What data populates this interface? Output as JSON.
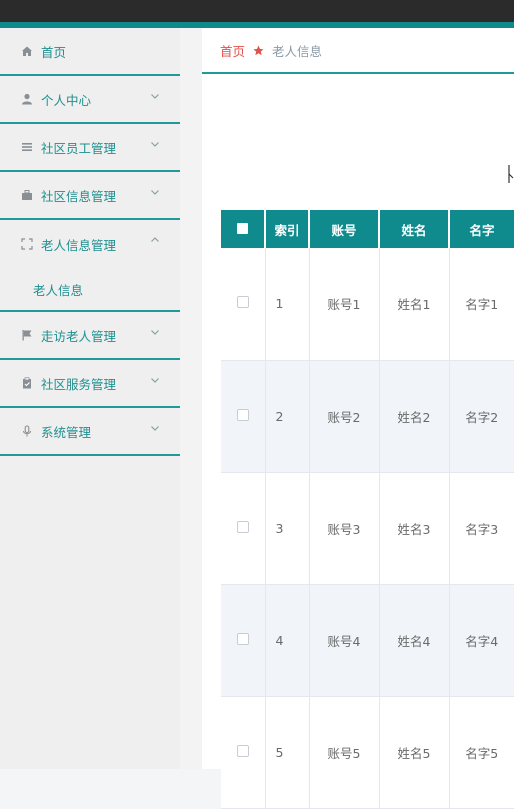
{
  "breadcrumb": {
    "home": "首页",
    "current": "老人信息"
  },
  "sidebar": {
    "items": [
      {
        "label": "首页",
        "icon": "home-icon"
      },
      {
        "label": "个人中心",
        "icon": "user-icon"
      },
      {
        "label": "社区员工管理",
        "icon": "list-icon"
      },
      {
        "label": "社区信息管理",
        "icon": "briefcase-icon"
      },
      {
        "label": "老人信息管理",
        "icon": "fullscreen-icon",
        "sub": "老人信息"
      },
      {
        "label": "走访老人管理",
        "icon": "flag-icon"
      },
      {
        "label": "社区服务管理",
        "icon": "clipboard-icon"
      },
      {
        "label": "系统管理",
        "icon": "microphone-icon"
      }
    ]
  },
  "table": {
    "headers": [
      "索引",
      "账号",
      "姓名",
      "名字"
    ],
    "rows": [
      {
        "index": "1",
        "account": "账号1",
        "surname": "姓名1",
        "name": "名字1"
      },
      {
        "index": "2",
        "account": "账号2",
        "surname": "姓名2",
        "name": "名字2"
      },
      {
        "index": "3",
        "account": "账号3",
        "surname": "姓名3",
        "name": "名字3"
      },
      {
        "index": "4",
        "account": "账号4",
        "surname": "姓名4",
        "name": "名字4"
      },
      {
        "index": "5",
        "account": "账号5",
        "surname": "姓名5",
        "name": "名字5"
      }
    ]
  },
  "colors": {
    "accent": "#0f8b8d",
    "breadcrumb_home": "#e0524a",
    "topbar": "#2b2b2b"
  }
}
